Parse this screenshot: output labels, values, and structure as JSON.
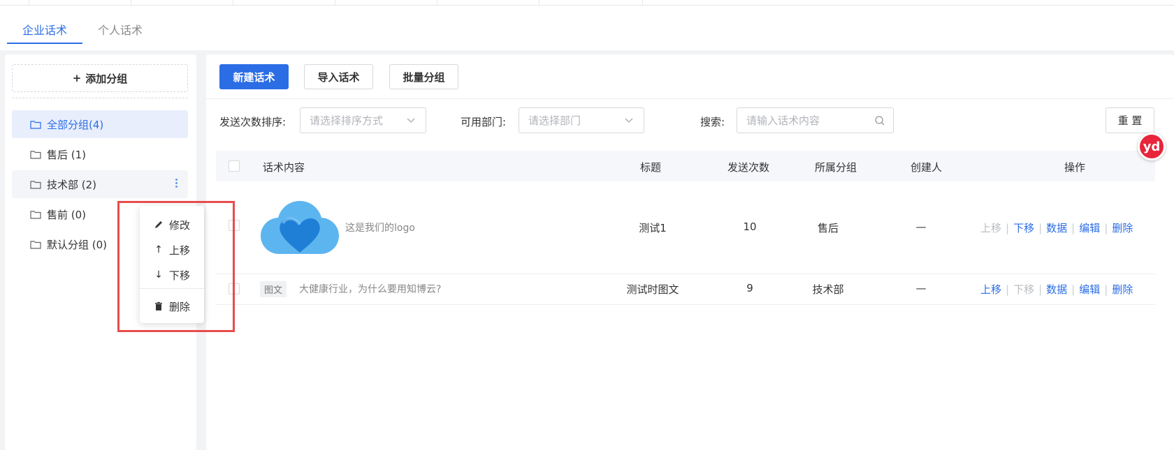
{
  "tabs": [
    {
      "label": "企业话术",
      "active": true
    },
    {
      "label": "个人话术",
      "active": false
    }
  ],
  "sidebar": {
    "add_group_label": "添加分组",
    "groups": [
      {
        "label": "全部分组(4)",
        "active": true
      },
      {
        "label": "售后 (1)",
        "active": false
      },
      {
        "label": "技术部 (2)",
        "active": false
      },
      {
        "label": "售前 (0)",
        "active": false
      },
      {
        "label": "默认分组 (0)",
        "active": false
      }
    ],
    "context_menu": {
      "edit": "修改",
      "move_up": "上移",
      "move_down": "下移",
      "delete": "删除"
    }
  },
  "toolbar": {
    "new_label": "新建话术",
    "import_label": "导入话术",
    "batch_group_label": "批量分组"
  },
  "filters": {
    "sort_label": "发送次数排序:",
    "sort_placeholder": "请选择排序方式",
    "dept_label": "可用部门:",
    "dept_placeholder": "请选择部门",
    "search_label": "搜索:",
    "search_placeholder": "请输入话术内容",
    "reset_label": "重 置"
  },
  "table": {
    "headers": {
      "content": "话术内容",
      "title": "标题",
      "send_count": "发送次数",
      "group": "所属分组",
      "creator": "创建人",
      "actions": "操作"
    },
    "rows": [
      {
        "content_text": "这是我们的logo",
        "title": "测试1",
        "send_count": "10",
        "group": "售后",
        "creator": "—",
        "move_up_disabled": true,
        "move_down_disabled": false
      },
      {
        "tag": "图文",
        "content_text": "大健康行业，为什么要用知博云?",
        "title": "测试时图文",
        "send_count": "9",
        "group": "技术部",
        "creator": "—",
        "move_up_disabled": false,
        "move_down_disabled": true
      }
    ],
    "action_labels": {
      "move_up": "上移",
      "move_down": "下移",
      "data": "数据",
      "edit": "编辑",
      "delete": "删除"
    }
  },
  "colors": {
    "accent": "#2b6de5",
    "highlight_box": "#e84c4c",
    "logo_light": "#5db5f0",
    "logo_dark": "#1f7fd6",
    "floating_badge": "#e8253a"
  },
  "floating_badge_label": "yd"
}
